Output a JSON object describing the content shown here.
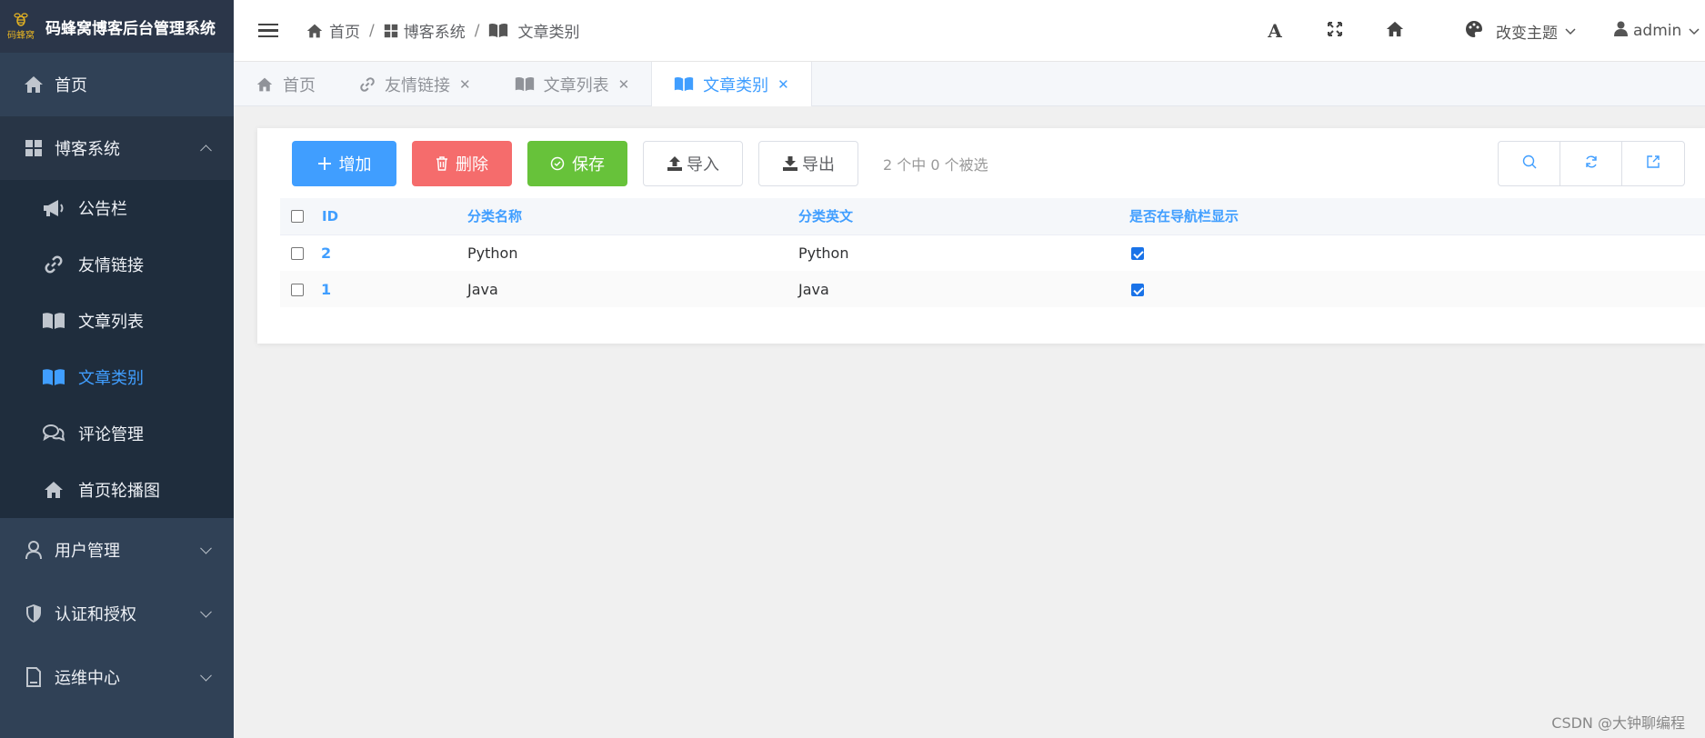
{
  "app": {
    "logo_text": "码蜂窝",
    "title": "码蜂窝博客后台管理系统"
  },
  "sidebar": {
    "items": [
      {
        "label": "首页",
        "icon": "home-icon"
      },
      {
        "label": "博客系统",
        "icon": "grid-icon",
        "expanded": true,
        "children": [
          {
            "label": "公告栏",
            "icon": "megaphone-icon"
          },
          {
            "label": "友情链接",
            "icon": "link-icon"
          },
          {
            "label": "文章列表",
            "icon": "book-icon"
          },
          {
            "label": "文章类别",
            "icon": "book-open-icon",
            "active": true
          },
          {
            "label": "评论管理",
            "icon": "comments-icon"
          },
          {
            "label": "首页轮播图",
            "icon": "home-icon"
          }
        ]
      },
      {
        "label": "用户管理",
        "icon": "user-icon"
      },
      {
        "label": "认证和授权",
        "icon": "shield-icon"
      },
      {
        "label": "运维中心",
        "icon": "document-icon"
      }
    ]
  },
  "breadcrumb": [
    "首页",
    "博客系统",
    "文章类别"
  ],
  "header": {
    "theme_label": "改变主题",
    "user": "admin"
  },
  "tabs": [
    {
      "label": "首页"
    },
    {
      "label": "友情链接",
      "closable": true
    },
    {
      "label": "文章列表",
      "closable": true
    },
    {
      "label": "文章类别",
      "closable": true,
      "active": true
    }
  ],
  "toolbar": {
    "add": "增加",
    "delete": "删除",
    "save": "保存",
    "import": "导入",
    "export": "导出",
    "selection_info": "2 个中 0 个被选"
  },
  "table": {
    "headers": [
      "ID",
      "分类名称",
      "分类英文",
      "是否在导航栏显示"
    ],
    "rows": [
      {
        "id": "2",
        "name": "Python",
        "english": "Python",
        "nav": true
      },
      {
        "id": "1",
        "name": "Java",
        "english": "Java",
        "nav": true
      }
    ]
  },
  "watermark": "CSDN @大钟聊编程",
  "colors": {
    "primary": "#409eff",
    "danger": "#f56c6c",
    "success": "#67c23a",
    "sidebar": "#304156",
    "sidebar_dark": "#1f2d3d"
  }
}
